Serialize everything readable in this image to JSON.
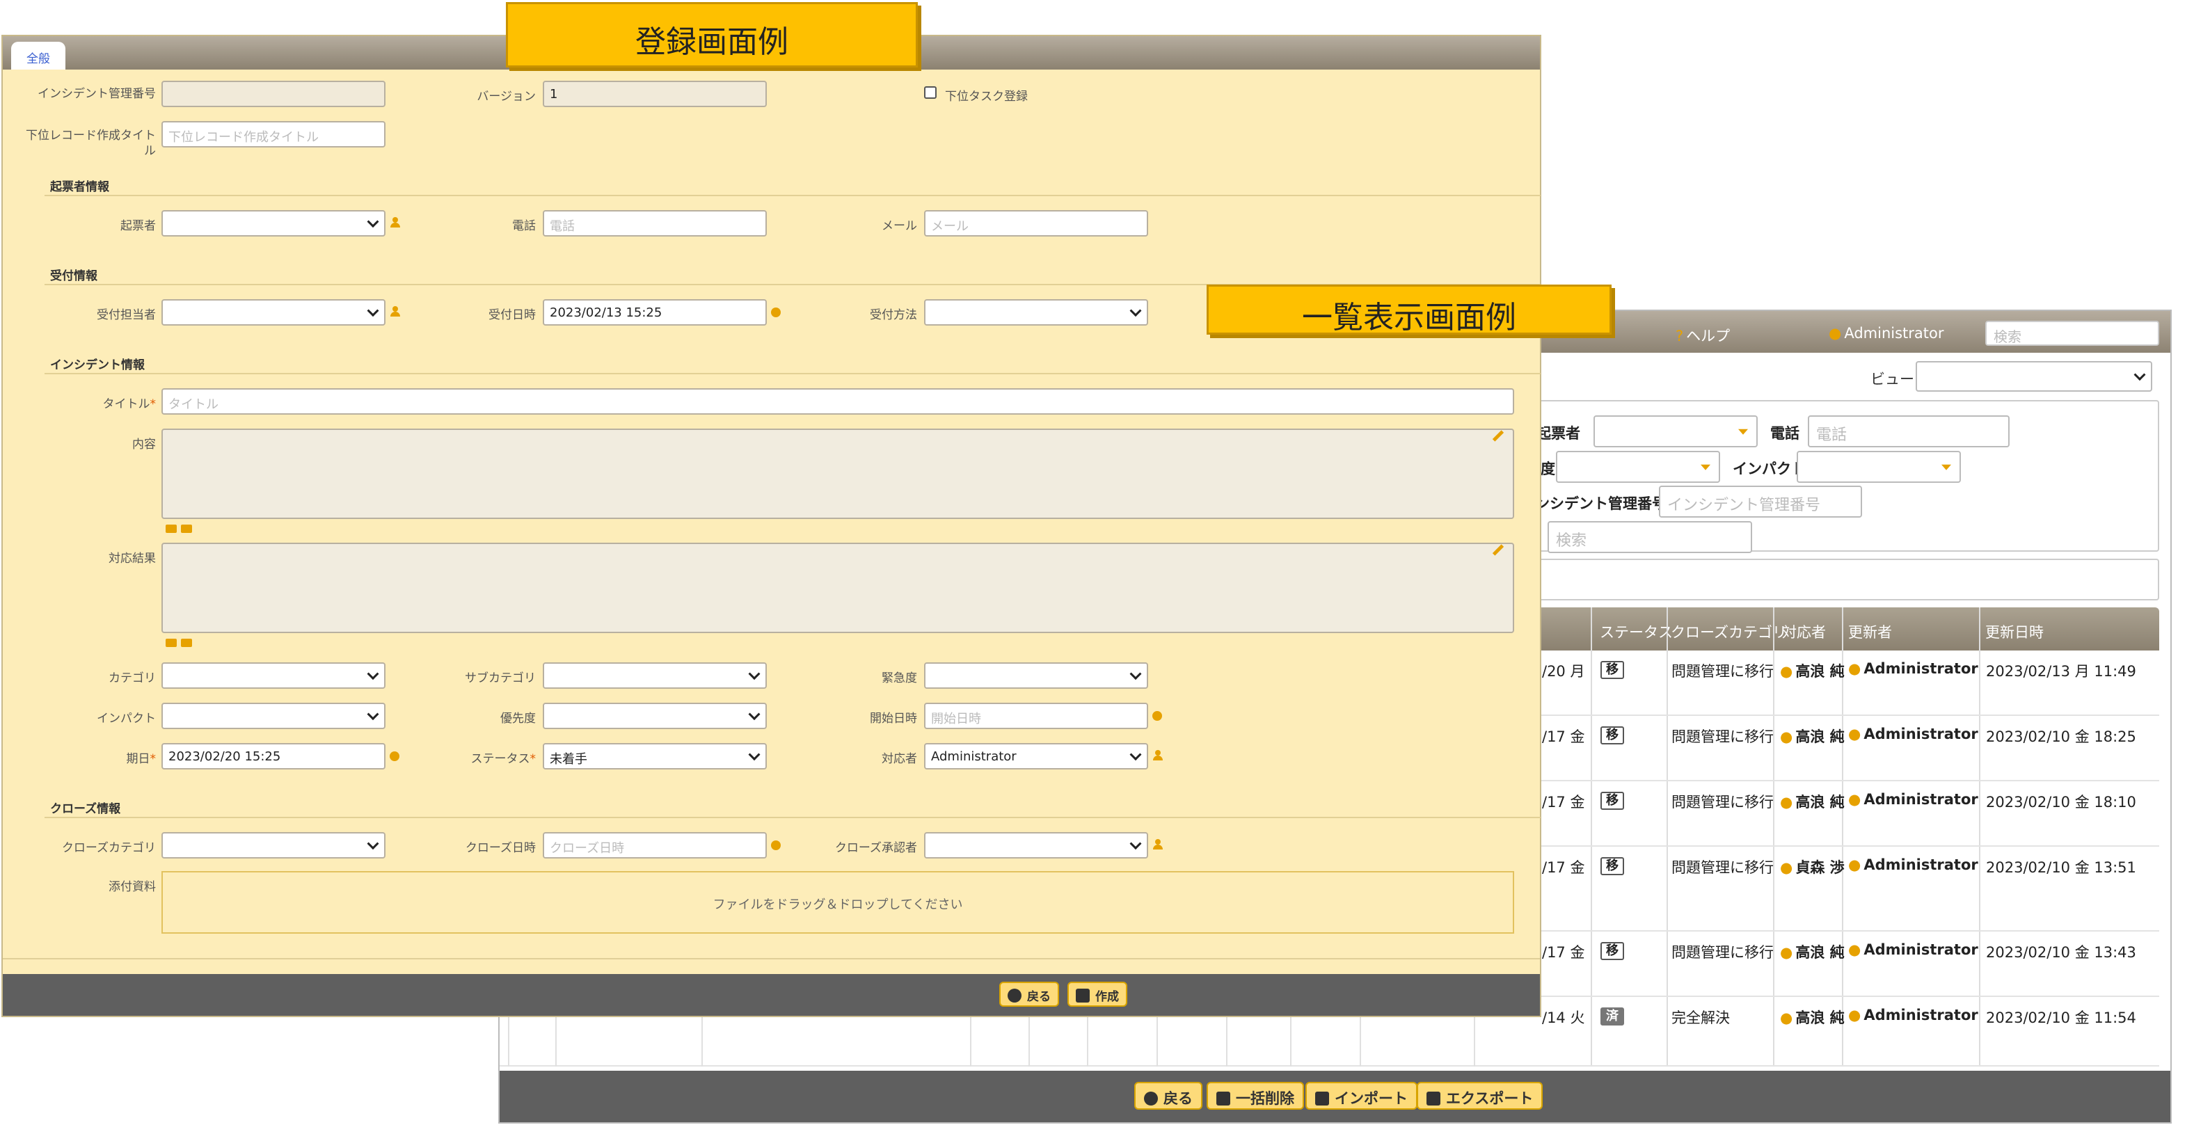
{
  "callouts": {
    "register": "登録画面例",
    "list": "一覧表示画面例"
  },
  "list_view": {
    "topbar": {
      "help": "ヘルプ",
      "user": "Administrator",
      "search_placeholder": "検索"
    },
    "view_label": "ビュー",
    "filters": {
      "reporter": "起票者",
      "phone_label": "電話",
      "phone_placeholder": "電話",
      "degree_partial": "度",
      "impact": "インパクト",
      "incident_no_label": "ンシデント管理番号",
      "incident_no_placeholder": "インシデント管理番号",
      "search_placeholder": "検索"
    },
    "columns": [
      "ステータス",
      "クローズカテゴリ",
      "対応者",
      "更新者",
      "更新日時"
    ],
    "rows": [
      {
        "date_partial": "/20 月",
        "status": "移",
        "close_category": "問題管理に移行",
        "assignee": "高浪 純",
        "updater": "Administrator",
        "updated": "2023/02/13 月 11:49"
      },
      {
        "date_partial": "/17 金",
        "status": "移",
        "close_category": "問題管理に移行",
        "assignee": "高浪 純",
        "updater": "Administrator",
        "updated": "2023/02/10 金 18:25"
      },
      {
        "date_partial": "/17 金",
        "status": "移",
        "close_category": "問題管理に移行",
        "assignee": "高浪 純",
        "updater": "Administrator",
        "updated": "2023/02/10 金 18:10"
      },
      {
        "date_partial": "/17 金",
        "status": "移",
        "close_category": "問題管理に移行",
        "assignee": "貞森 渉",
        "updater": "Administrator",
        "updated": "2023/02/10 金 13:51"
      },
      {
        "date_partial": "/17 金",
        "status": "移",
        "close_category": "問題管理に移行",
        "assignee": "高浪 純",
        "updater": "Administrator",
        "updated": "2023/02/10 金 13:43"
      },
      {
        "date_partial": "/14 火",
        "status": "済",
        "close_category": "完全解決",
        "assignee": "高浪 純",
        "updater": "Administrator",
        "updated": "2023/02/10 金 11:54"
      }
    ],
    "footer": {
      "back": "戻る",
      "bulk_delete": "一括削除",
      "import": "インポート",
      "export": "エクスポート"
    }
  },
  "form": {
    "tab": "全般",
    "incident_no_label": "インシデント管理番号",
    "version_label": "バージョン",
    "version_value": "1",
    "subtask_label": "下位タスク登録",
    "sub_title_label": "下位レコード作成タイトル",
    "sub_title_placeholder": "下位レコード作成タイトル",
    "section_reporter": "起票者情報",
    "reporter_label": "起票者",
    "phone_label": "電話",
    "phone_placeholder": "電話",
    "mail_label": "メール",
    "mail_placeholder": "メール",
    "section_reception": "受付情報",
    "receiver_label": "受付担当者",
    "received_at_label": "受付日時",
    "received_at_value": "2023/02/13 15:25",
    "reception_method_label": "受付方法",
    "section_incident": "インシデント情報",
    "title_label": "タイトル",
    "title_placeholder": "タイトル",
    "content_label": "内容",
    "result_label": "対応結果",
    "category_label": "カテゴリ",
    "subcategory_label": "サブカテゴリ",
    "urgency_label": "緊急度",
    "impact_label": "インパクト",
    "priority_label": "優先度",
    "start_label": "開始日時",
    "start_placeholder": "開始日時",
    "due_label": "期日",
    "due_value": "2023/02/20 15:25",
    "status_label": "ステータス",
    "status_value": "未着手",
    "assignee_label": "対応者",
    "assignee_value": "Administrator",
    "section_close": "クローズ情報",
    "close_category_label": "クローズカテゴリ",
    "close_at_label": "クローズ日時",
    "close_at_placeholder": "クローズ日時",
    "close_approver_label": "クローズ承認者",
    "attachment_label": "添付資料",
    "drop_text": "ファイルをドラッグ＆ドロップしてください",
    "footer": {
      "back": "戻る",
      "create": "作成"
    }
  }
}
